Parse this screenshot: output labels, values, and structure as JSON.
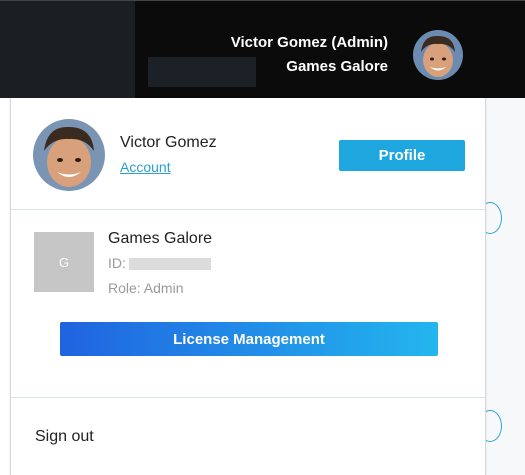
{
  "header": {
    "user_display": "Victor Gomez (Admin)",
    "company": "Games Galore",
    "avatar_icon": "user-avatar"
  },
  "profile": {
    "name": "Victor Gomez",
    "account_link": "Account",
    "profile_button": "Profile"
  },
  "organization": {
    "tile_letter": "G",
    "name": "Games Galore",
    "id_label": "ID:",
    "role": "Role: Admin",
    "license_button": "License Management"
  },
  "footer": {
    "sign_out": "Sign out"
  },
  "colors": {
    "header_bg": "#0b0b0b",
    "accent": "#1ea7de",
    "license_gradient_start": "#2063e0",
    "license_gradient_end": "#23b6ee"
  }
}
